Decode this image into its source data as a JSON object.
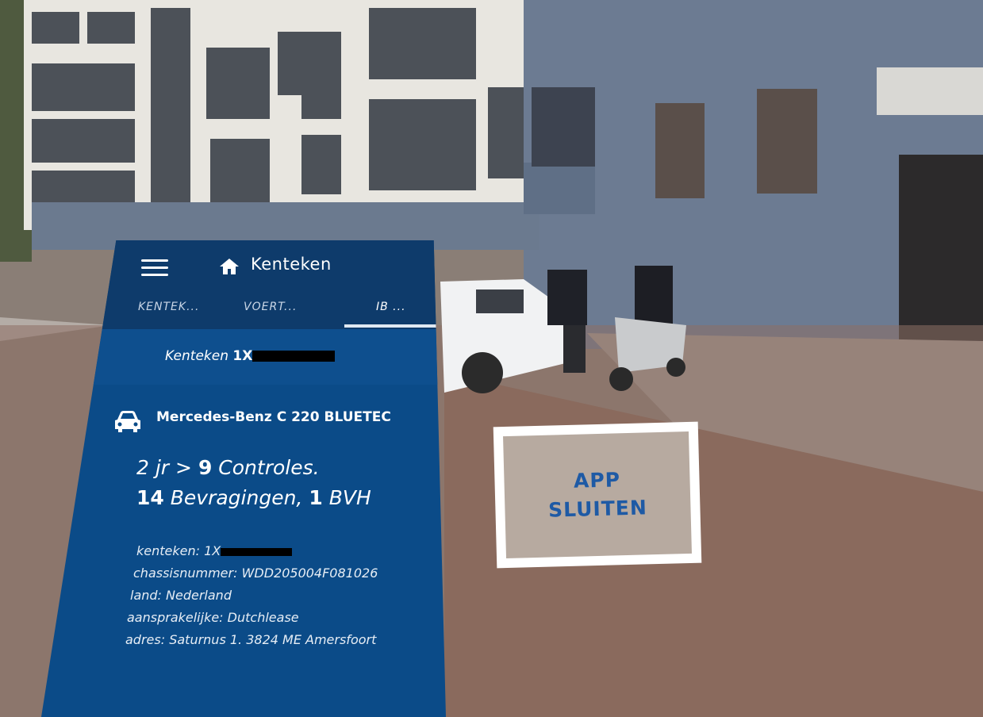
{
  "header": {
    "title": "Kenteken"
  },
  "tabs": [
    {
      "label": "KENTEK..."
    },
    {
      "label": "VOERT..."
    },
    {
      "label": "IB ...",
      "active": true
    }
  ],
  "plate": {
    "label": "Kenteken",
    "value_visible": "1X"
  },
  "vehicle": {
    "name": "Mercedes-Benz C 220 BLUETEC",
    "stats": {
      "period": "2 jr >",
      "controls_count": "9",
      "controls_label": "Controles.",
      "queries_count": "14",
      "queries_label": "Bevragingen,",
      "bvh_count": "1",
      "bvh_label": "BVH"
    }
  },
  "details": {
    "kenteken_label": "kenteken:",
    "kenteken_value": "1X",
    "chassis_label": "chassisnummer:",
    "chassis_value": "WDD205004F081026",
    "land_label": "land:",
    "land_value": "Nederland",
    "aansprakelijke_label": "aansprakelijke:",
    "aansprakelijke_value": "Dutchlease",
    "adres_label": "adres:",
    "adres_value": "Saturnus 1. 3824 ME Amersfoort"
  },
  "close_button": {
    "label": "APP\nSLUITEN"
  },
  "colors": {
    "panel": "#0b4b88",
    "panel_header": "#0e3b6b",
    "accent_text": "#1e5aa5"
  },
  "icons": {
    "menu": "hamburger-menu-icon",
    "home": "home-icon",
    "car": "car-icon"
  }
}
